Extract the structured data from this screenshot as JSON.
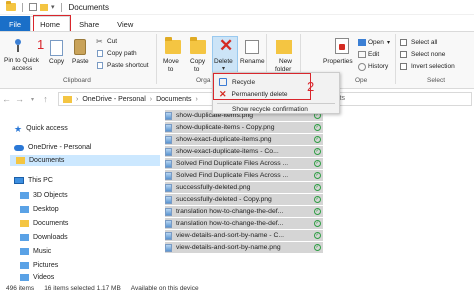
{
  "window": {
    "title": "Documents"
  },
  "tabs": [
    {
      "label": "File"
    },
    {
      "label": "Home"
    },
    {
      "label": "Share"
    },
    {
      "label": "View"
    }
  ],
  "ribbon": {
    "clipboard": {
      "pin_label_1": "Pin to Quick",
      "pin_label_2": "access",
      "copy_label": "Copy",
      "paste_label": "Paste",
      "cut_label": "Cut",
      "copy_path_label": "Copy path",
      "paste_shortcut_label": "Paste shortcut",
      "group_label": "Clipboard"
    },
    "organize": {
      "move_to_label_1": "Move",
      "move_to_label_2": "to",
      "copy_to_label_1": "Copy",
      "copy_to_label_2": "to",
      "delete_label": "Delete",
      "rename_label": "Rename",
      "group_label_partial": "Orga"
    },
    "new": {
      "new_folder_label_1": "New",
      "new_folder_label_2": "folder"
    },
    "open": {
      "properties_label": "Properties",
      "open_label": "Open",
      "edit_label": "Edit",
      "history_label": "History",
      "group_label_partial": "Ope"
    },
    "select": {
      "select_all_label": "Select all",
      "select_none_label": "Select none",
      "invert_label": "Invert selection",
      "group_label": "Select"
    }
  },
  "delete_menu": {
    "recycle_label": "Recycle",
    "permanent_label": "Permanently delete",
    "confirm_label": "Show recycle confirmation"
  },
  "annotations": {
    "one": "1",
    "two": "2"
  },
  "address": {
    "root": "OneDrive - Personal",
    "current": "Documents",
    "partial": "ments"
  },
  "nav": {
    "quick_access": "Quick access",
    "onedrive": "OneDrive - Personal",
    "documents": "Documents",
    "this_pc": "This PC",
    "objects_3d": "3D Objects",
    "desktop": "Desktop",
    "documents_pc": "Documents",
    "downloads": "Downloads",
    "music": "Music",
    "pictures": "Pictures",
    "videos": "Videos"
  },
  "files": [
    {
      "name": "show-duplicate-items.png"
    },
    {
      "name": "show-duplicate-items - Copy.png"
    },
    {
      "name": "show-exact-duplicate-items.png"
    },
    {
      "name": "show-exact-duplicate-items - Co..."
    },
    {
      "name": "Solved Find Duplicate Files Across ..."
    },
    {
      "name": "Solved Find Duplicate Files Across ..."
    },
    {
      "name": "successfully-deleted.png"
    },
    {
      "name": "successfully-deleted - Copy.png"
    },
    {
      "name": "translation how-to-change-the-def..."
    },
    {
      "name": "translation how-to-change-the-def..."
    },
    {
      "name": "view-details-and-sort-by-name - C..."
    },
    {
      "name": "view-details-and-sort-by-name.png"
    }
  ],
  "status": {
    "items": "496 items",
    "selected": "16 items selected  1.17 MB",
    "availability": "Available on this device"
  }
}
